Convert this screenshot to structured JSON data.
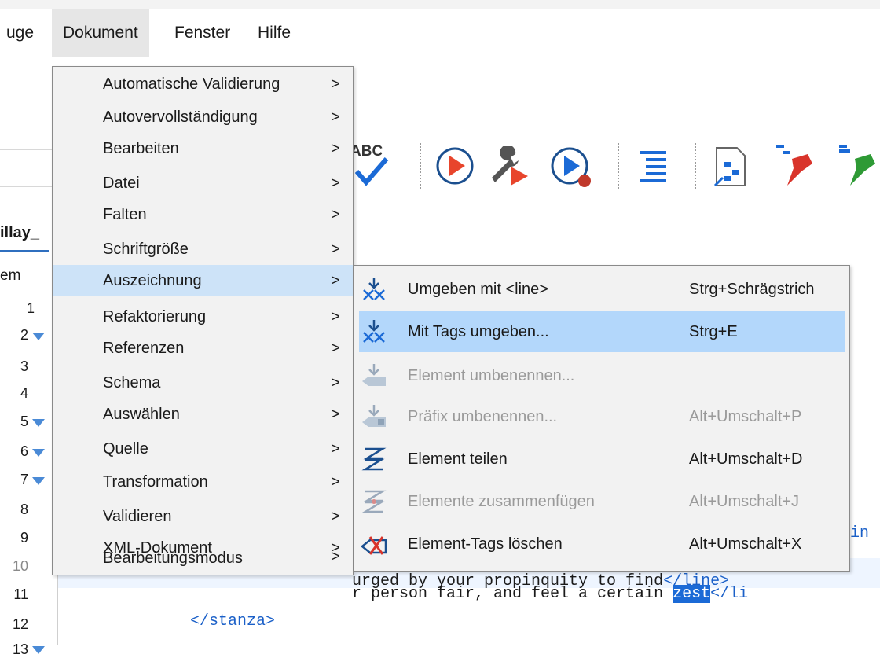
{
  "menubar": {
    "items": [
      "uge",
      "Dokument",
      "Fenster",
      "Hilfe"
    ],
    "active": "Dokument"
  },
  "background": {
    "tab_title": "illay_",
    "element_label": "em",
    "line_numbers": [
      "1",
      "2",
      "3",
      "4",
      "5",
      "6",
      "7",
      "8",
      "9",
      "10",
      "11",
      "12",
      "13"
    ]
  },
  "toolbar": {
    "icons": [
      "spellcheck-icon",
      "run-transformation-icon",
      "configure-transformation-icon",
      "debug-transformation-icon",
      "format-indent-icon",
      "xml-schema-icon",
      "pin-red-icon",
      "pin-green-icon"
    ],
    "spell_label": "ABC"
  },
  "editor": {
    "line9_tail": "in",
    "line10_text": "urged by your propinquity to find",
    "line10_close": "</line>",
    "line11_text": "r person fair, and feel a certain ",
    "line11_selected": "zest",
    "line11_close": "</li",
    "line12_text": "</stanza>"
  },
  "dokument_menu": {
    "items": [
      "Automatische Validierung",
      "Autovervollständigung",
      "Bearbeiten",
      "Datei",
      "Falten",
      "Schriftgröße",
      "Auszeichnung",
      "Refaktorierung",
      "Referenzen",
      "Schema",
      "Auswählen",
      "Quelle",
      "Transformation",
      "Validieren",
      "XML-Dokument",
      "Bearbeitungsmodus"
    ],
    "arrow": ">",
    "selected": "Auszeichnung"
  },
  "submenu": {
    "items": [
      {
        "label": "Umgeben mit <line>",
        "shortcut": "Strg+Schrägstrich",
        "icon": "surround-tag-icon",
        "enabled": true
      },
      {
        "label": "Mit Tags umgeben...",
        "shortcut": "Strg+E",
        "icon": "surround-tags-icon",
        "enabled": true
      },
      {
        "label": "Element umbenennen...",
        "shortcut": "",
        "icon": "rename-element-icon",
        "enabled": false
      },
      {
        "label": "Präfix umbenennen...",
        "shortcut": "Alt+Umschalt+P",
        "icon": "rename-prefix-icon",
        "enabled": false
      },
      {
        "label": "Element teilen",
        "shortcut": "Alt+Umschalt+D",
        "icon": "split-element-icon",
        "enabled": true
      },
      {
        "label": "Elemente zusammenfügen",
        "shortcut": "Alt+Umschalt+J",
        "icon": "join-elements-icon",
        "enabled": false
      },
      {
        "label": "Element-Tags löschen",
        "shortcut": "Alt+Umschalt+X",
        "icon": "delete-tags-icon",
        "enabled": true
      }
    ],
    "selected": "Mit Tags umgeben..."
  },
  "colors": {
    "menu_bg": "#f2f2f2",
    "menu_selected": "#cde3f8",
    "submenu_selected": "#b3d7fb",
    "tag_blue": "#1b60c8",
    "selection": "#1b6ad6"
  }
}
